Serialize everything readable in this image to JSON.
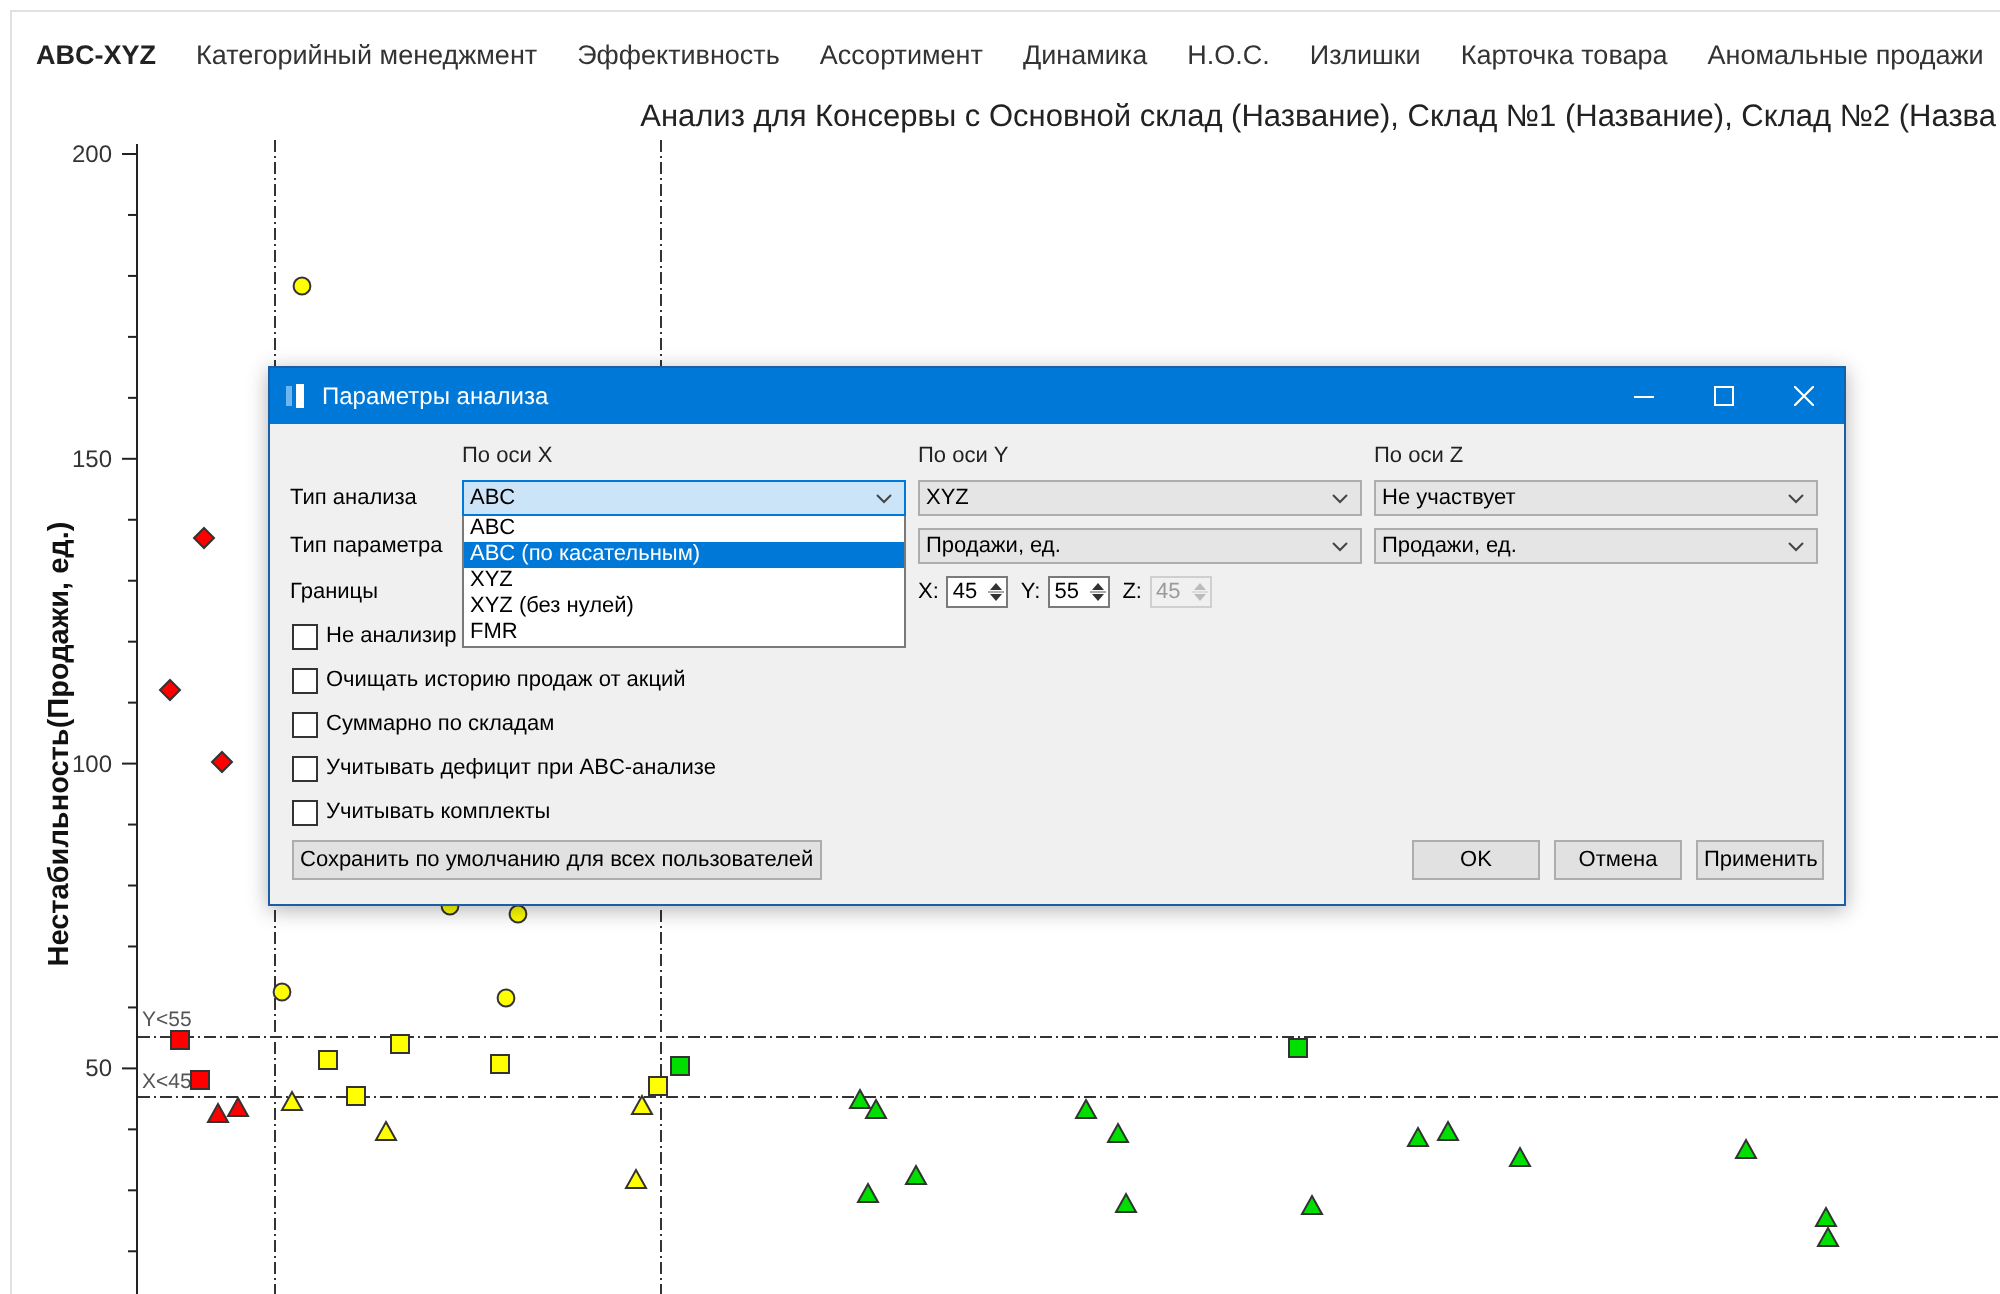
{
  "nav": {
    "tabs": [
      {
        "label": "ABC-XYZ",
        "selected": true
      },
      {
        "label": "Категорийный менеджмент",
        "selected": false
      },
      {
        "label": "Эффективность",
        "selected": false
      },
      {
        "label": "Ассортимент",
        "selected": false
      },
      {
        "label": "Динамика",
        "selected": false
      },
      {
        "label": "Н.О.С.",
        "selected": false
      },
      {
        "label": "Излишки",
        "selected": false
      },
      {
        "label": "Карточка товара",
        "selected": false
      },
      {
        "label": "Аномальные продажи",
        "selected": false
      }
    ]
  },
  "chart": {
    "title": "Анализ для Консервы с Основной склад (Название), Склад №1 (Название), Склад №2 (Назва",
    "y_axis": {
      "label": "Нестабильность(Продажи, ед.)",
      "ticks": [
        "200",
        "150",
        "100",
        "50"
      ]
    },
    "threshold_labels": [
      "Y<55",
      "X<45"
    ]
  },
  "dialog": {
    "title": "Параметры анализа",
    "columns": [
      "По оси X",
      "По оси Y",
      "По оси Z"
    ],
    "row_labels": [
      "Тип анализа",
      "Тип параметра",
      "Границы"
    ],
    "analysis_type": [
      {
        "value": "ABC",
        "open": true
      },
      {
        "value": "XYZ",
        "open": false
      },
      {
        "value": "Не участвует",
        "open": false
      }
    ],
    "dropdown_options": [
      {
        "label": "ABC",
        "selected": false
      },
      {
        "label": "ABC (по касательным)",
        "selected": true
      },
      {
        "label": "XYZ",
        "selected": false
      },
      {
        "label": "XYZ (без нулей)",
        "selected": false
      },
      {
        "label": "FMR",
        "selected": false
      }
    ],
    "parameter_type": [
      "Продажи, ед.",
      "Продажи, ед."
    ],
    "bounds": [
      {
        "label": "X:",
        "value": "45",
        "disabled": false
      },
      {
        "label": "Y:",
        "value": "55",
        "disabled": false
      },
      {
        "label": "Z:",
        "value": "45",
        "disabled": true
      }
    ],
    "checkboxes": [
      {
        "label": "Не анализир",
        "checked": false
      },
      {
        "label": "Очищать историю продаж от акций",
        "checked": false
      },
      {
        "label": "Суммарно по складам",
        "checked": false
      },
      {
        "label": "Учитывать дефицит при ABC-анализе",
        "checked": false
      },
      {
        "label": "Учитывать комплекты",
        "checked": false
      }
    ],
    "save_button": "Сохранить по умолчанию для всех пользователей",
    "buttons": [
      "OK",
      "Отмена",
      "Применить"
    ]
  }
}
